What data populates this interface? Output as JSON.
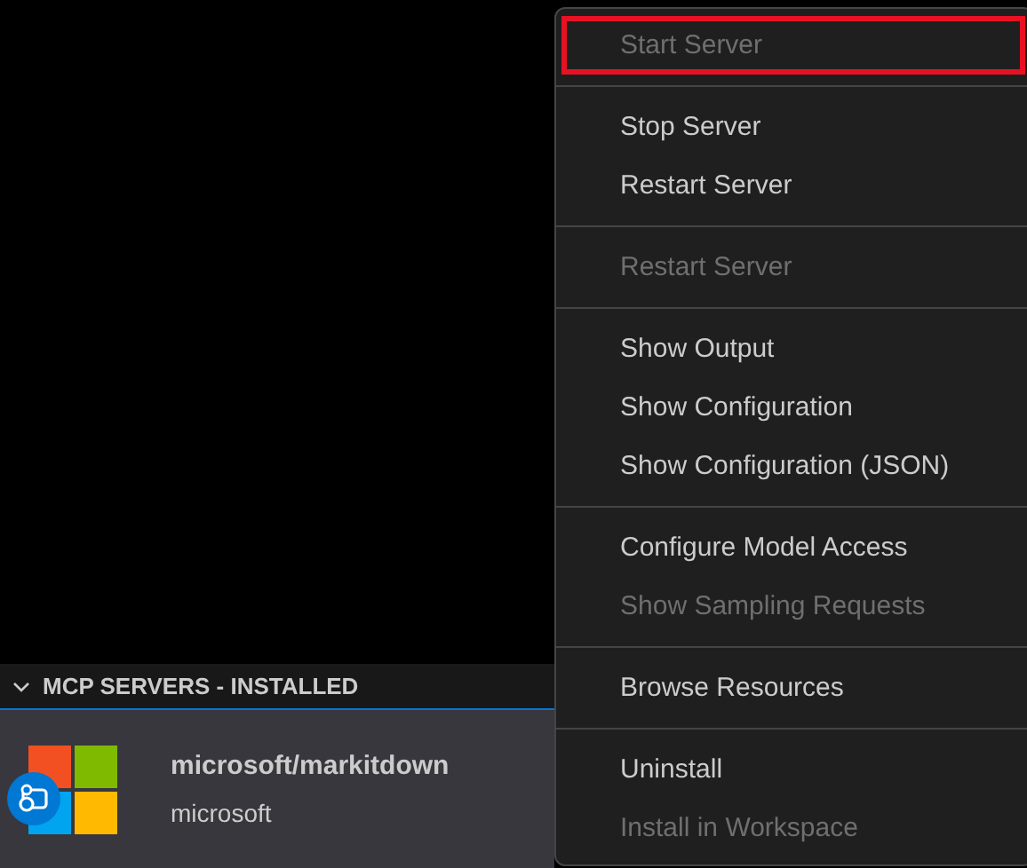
{
  "panel": {
    "title": "MCP SERVERS - INSTALLED",
    "expanded": true
  },
  "server": {
    "name": "microsoft/markitdown",
    "publisher": "microsoft",
    "selected": true
  },
  "context_menu": {
    "groups": [
      [
        {
          "label": "Start Server",
          "disabled": true,
          "highlighted": true
        }
      ],
      [
        {
          "label": "Stop Server",
          "disabled": false,
          "highlighted": false
        },
        {
          "label": "Restart Server",
          "disabled": false,
          "highlighted": false
        }
      ],
      [
        {
          "label": "Restart Server",
          "disabled": true,
          "highlighted": false
        }
      ],
      [
        {
          "label": "Show Output",
          "disabled": false,
          "highlighted": false
        },
        {
          "label": "Show Configuration",
          "disabled": false,
          "highlighted": false
        },
        {
          "label": "Show Configuration (JSON)",
          "disabled": false,
          "highlighted": false
        }
      ],
      [
        {
          "label": "Configure Model Access",
          "disabled": false,
          "highlighted": false
        },
        {
          "label": "Show Sampling Requests",
          "disabled": true,
          "highlighted": false
        }
      ],
      [
        {
          "label": "Browse Resources",
          "disabled": false,
          "highlighted": false
        }
      ],
      [
        {
          "label": "Uninstall",
          "disabled": false,
          "highlighted": false
        },
        {
          "label": "Install in Workspace",
          "disabled": true,
          "highlighted": false
        }
      ]
    ]
  }
}
